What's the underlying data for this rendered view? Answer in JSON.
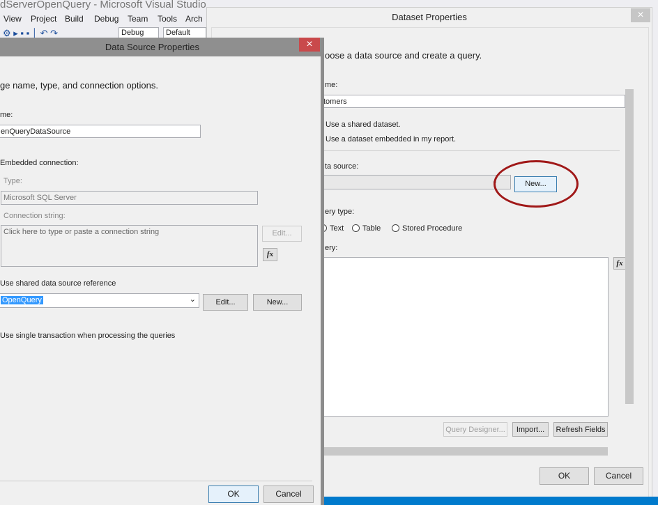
{
  "vs": {
    "title": "dServerOpenQuery - Microsoft Visual Studio",
    "menu": [
      "View",
      "Project",
      "Build",
      "Debug",
      "Team",
      "Tools",
      "Arch"
    ],
    "config": "Debug",
    "platform": "Default"
  },
  "dataset": {
    "title": "Dataset Properties",
    "close": "×",
    "intro": "oose a data source and create a query.",
    "name_label": "me:",
    "name_value": "tomers",
    "opt_shared": "Use a shared dataset.",
    "opt_embedded": "Use a dataset embedded in my report.",
    "ds_label": "ta source:",
    "new_btn": "New...",
    "qtype_label": "ery type:",
    "qtype_text": "Text",
    "qtype_table": "Table",
    "qtype_sp": "Stored Procedure",
    "query_label": "ery:",
    "fx": "fx",
    "query_designer": "Query Designer...",
    "import": "Import...",
    "refresh": "Refresh Fields",
    "ok": "OK",
    "cancel": "Cancel"
  },
  "datasource": {
    "title": "Data Source Properties",
    "close": "×",
    "intro": "ge name, type, and connection options.",
    "name_label": "me:",
    "name_value": "enQueryDataSource",
    "embedded": "Embedded connection:",
    "type_label": "Type:",
    "type_value": "Microsoft SQL Server",
    "conn_label": "Connection string:",
    "conn_placeholder": "Click here to type or paste a connection string",
    "edit_disabled": "Edit...",
    "fx": "fx",
    "shared_ref": "Use shared data source reference",
    "shared_value": "OpenQuery",
    "edit": "Edit...",
    "new": "New...",
    "single_tx": "Use single transaction when processing the queries",
    "ok": "OK",
    "cancel": "Cancel"
  }
}
